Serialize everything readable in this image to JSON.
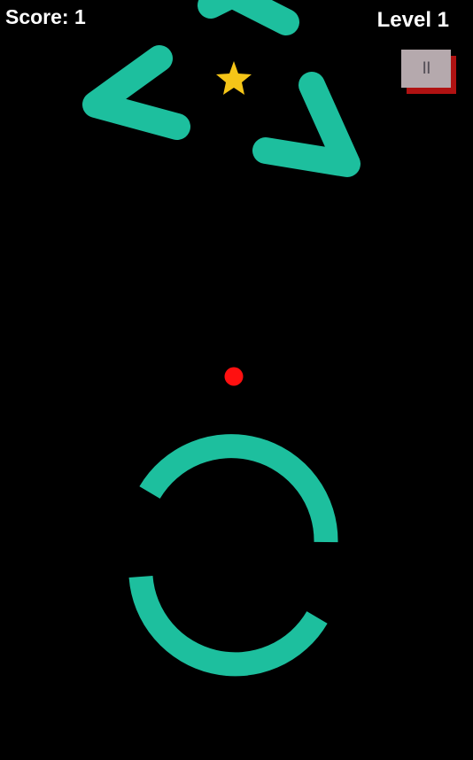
{
  "hud": {
    "score_text": "Score: 1",
    "level_text": "Level 1",
    "pause_symbol": "II"
  },
  "colors": {
    "background": "#000000",
    "obstacle": "#1dbf9e",
    "ball": "#ff1010",
    "star": "#f5c518",
    "hud_text": "#ffffff",
    "pause_face": "#b5a9ad",
    "pause_shadow": "#b01212",
    "pause_glyph": "#555058"
  },
  "icons": {
    "pause": "pause-icon",
    "star": "star-icon"
  }
}
